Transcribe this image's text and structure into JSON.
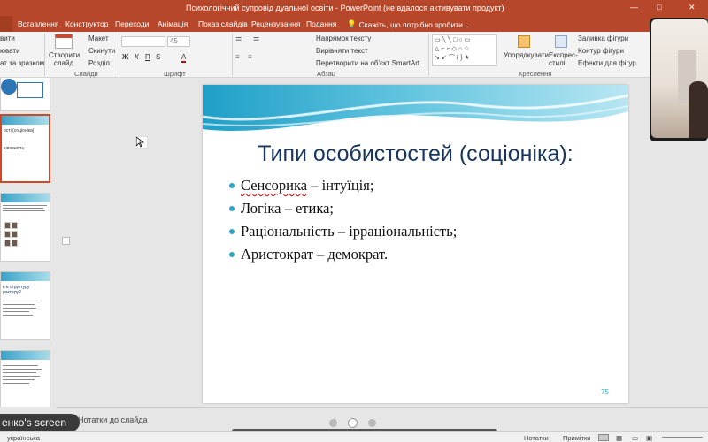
{
  "window": {
    "title": "Психологічний супровід дуальної освіти - PowerPoint (не вдалося активувати продукт)",
    "controls": [
      "—",
      "□",
      "✕"
    ]
  },
  "tabs": [
    {
      "label": "Вставлення"
    },
    {
      "label": "Конструктор"
    },
    {
      "label": "Переходи"
    },
    {
      "label": "Анімація"
    },
    {
      "label": "Показ слайдів"
    },
    {
      "label": "Рецензування"
    },
    {
      "label": "Подання"
    }
  ],
  "tell_me": "Скажіть, що потрібно зробити...",
  "ribbon": {
    "clipboard": {
      "b1": "вити",
      "b2": "ювати",
      "b3": "ат за зразком"
    },
    "slides": {
      "new_slide": "Створити слайд",
      "layout": "Макет",
      "reset": "Скинути",
      "section": "Розділ",
      "label": "Слайди"
    },
    "font": {
      "size": "45",
      "bold": "Ж",
      "italic": "К",
      "underline": "П",
      "strike": "S",
      "label": "Шрифт"
    },
    "paragraph": {
      "direction": "Напрямок тексту",
      "align": "Вирівняти текст",
      "smartart": "Перетворити на об'єкт SmartArt",
      "label": "Абзац"
    },
    "drawing": {
      "arrange": "Упорядкувати",
      "quick_styles": "Експрес-стилі",
      "fill": "Заливка фігури",
      "outline": "Контур фігури",
      "effects": "Ефекти для фігур",
      "label": "Креслення"
    }
  },
  "slide": {
    "title": "Типи особистостей (соціоніка):",
    "bullets": [
      {
        "underlined": "Сенсорика",
        "rest": " – інтуїція;"
      },
      {
        "underlined": "",
        "rest": "Логіка – етика;"
      },
      {
        "underlined": "",
        "rest": "Раціональність – ірраціональність;"
      },
      {
        "underlined": "",
        "rest": "Аристократ – демократ."
      }
    ],
    "number": "75"
  },
  "thumbnails": [
    {
      "text": "ості (соціоніка):",
      "sub": "ювавність;"
    },
    {
      "text": "",
      "sub": ""
    },
    {
      "text": "ь в структуру\nрактеру?",
      "sub": ""
    },
    {
      "text": "",
      "sub": ""
    }
  ],
  "notes_placeholder": "Нотатки до слайда",
  "screen_share_label": "енко's screen",
  "statusbar": {
    "language": "українська",
    "notes": "Нотатки",
    "comments": "Примітки"
  },
  "colors": {
    "ribbon_accent": "#b7472a",
    "title_color": "#17365d",
    "bullet_color": "#2ea6c8"
  }
}
